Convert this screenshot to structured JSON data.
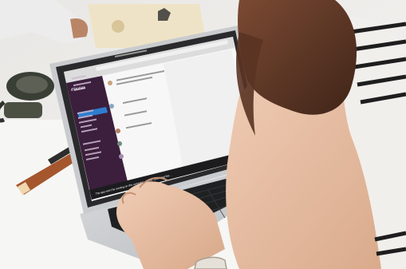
{
  "photo": {
    "subject": "Person typing on a laptop showing a team chat web app",
    "colors": {
      "background": "#f2f1ef",
      "table": "#f7f7f6",
      "laptop_body": "#cfd1d3",
      "laptop_bezel": "#2a2a2c",
      "sidebar": "#3b1f3c",
      "sidebar_active": "#2f7dd0",
      "app_bg": "#f9f9f9",
      "skin": "#e8c2a8",
      "hair": "#6a3f2b",
      "shirt_stripe": "#1e1e1e"
    }
  },
  "screen": {
    "workspace_name": "dStories",
    "sidebar_items": [
      "Threads",
      "All unreads",
      "Apps",
      "",
      "",
      "",
      "",
      "",
      "",
      "",
      "",
      ""
    ],
    "bottom_banner": "The app won't be running on this computer, please, download the..."
  }
}
